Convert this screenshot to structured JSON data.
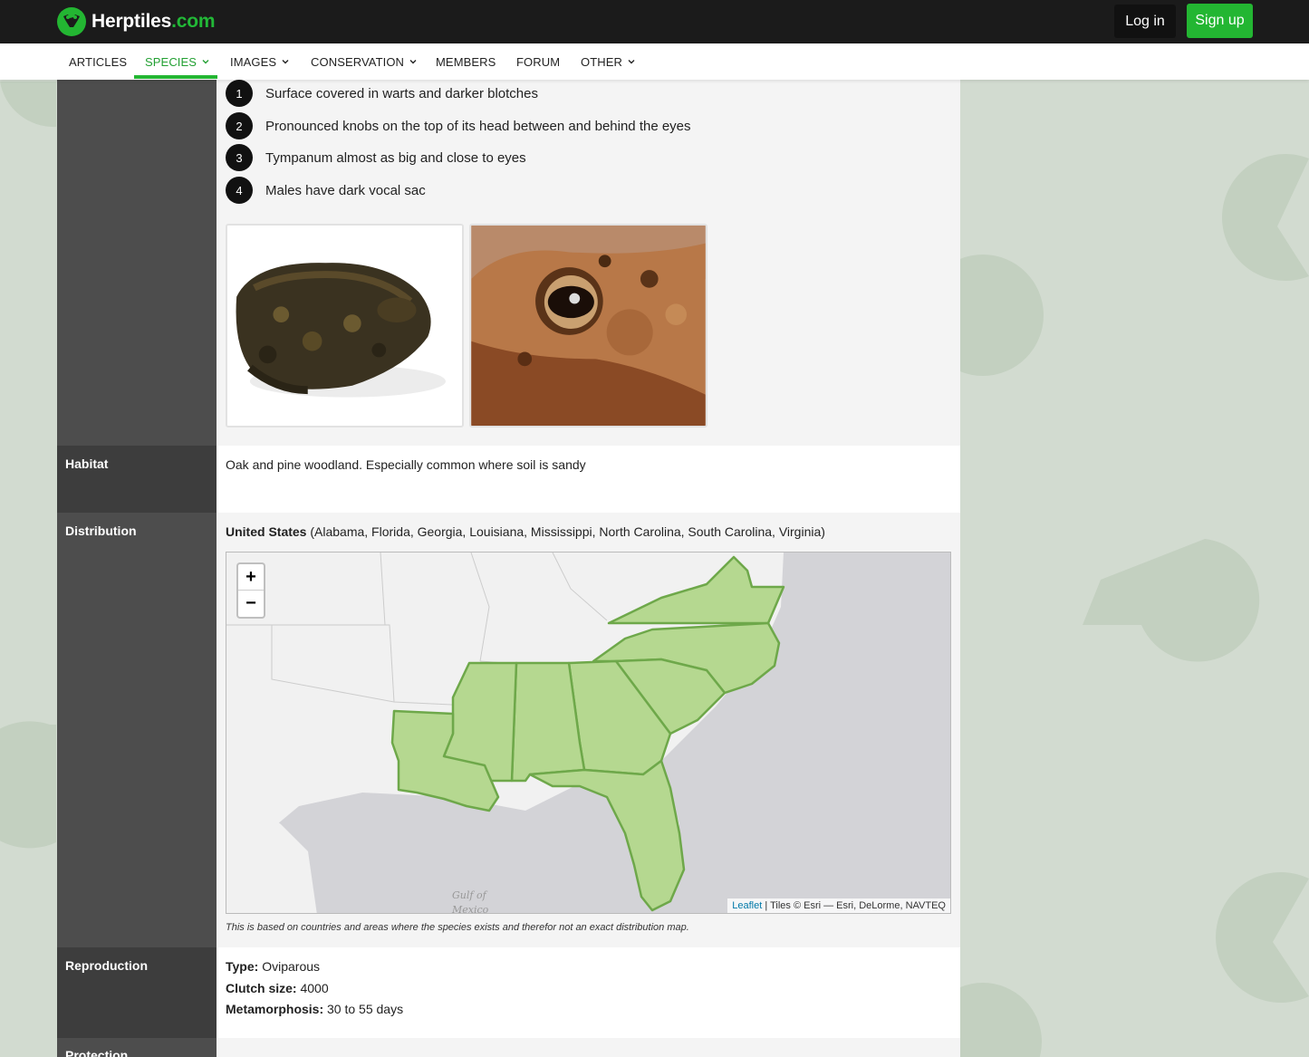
{
  "brand": {
    "name": "Herptiles",
    "tld": ".com",
    "accent": "#23b632"
  },
  "auth": {
    "login": "Log in",
    "signup": "Sign up"
  },
  "nav": [
    {
      "label": "ARTICLES",
      "dropdown": false
    },
    {
      "label": "SPECIES",
      "dropdown": true,
      "active": true
    },
    {
      "label": "IMAGES",
      "dropdown": true
    },
    {
      "label": "CONSERVATION",
      "dropdown": true
    },
    {
      "label": "MEMBERS",
      "dropdown": false
    },
    {
      "label": "FORUM",
      "dropdown": false
    },
    {
      "label": "OTHER",
      "dropdown": true
    }
  ],
  "identification": {
    "features": [
      {
        "num": "1",
        "text": "Surface covered in warts and darker blotches"
      },
      {
        "num": "2",
        "text": "Pronounced knobs on the top of its head between and behind the eyes"
      },
      {
        "num": "3",
        "text": "Tympanum almost as big and close to eyes"
      },
      {
        "num": "4",
        "text": "Males have dark vocal sac"
      }
    ]
  },
  "habitat": {
    "label": "Habitat",
    "text": "Oak and pine woodland. Especially common where soil is sandy"
  },
  "distribution": {
    "label": "Distribution",
    "country": "United States",
    "regions": "(Alabama, Florida, Georgia, Louisiana, Mississippi, North Carolina, South Carolina, Virginia)",
    "map": {
      "zoom_in": "+",
      "zoom_out": "−",
      "attribution_link": "Leaflet",
      "attribution_text": "| Tiles © Esri — Esri, DeLorme, NAVTEQ",
      "water_label_1": "Gulf of",
      "water_label_2": "Mexico",
      "highlight_color": "#b5d890",
      "border_color": "#6ea84a"
    },
    "note": "This is based on countries and areas where the species exists and therefor not an exact distribution map."
  },
  "reproduction": {
    "label": "Reproduction",
    "type_label": "Type:",
    "type_value": "Oviparous",
    "clutch_label": "Clutch size:",
    "clutch_value": "4000",
    "meta_label": "Metamorphosis:",
    "meta_value": "30 to 55 days"
  },
  "protection": {
    "label": "Protection"
  }
}
